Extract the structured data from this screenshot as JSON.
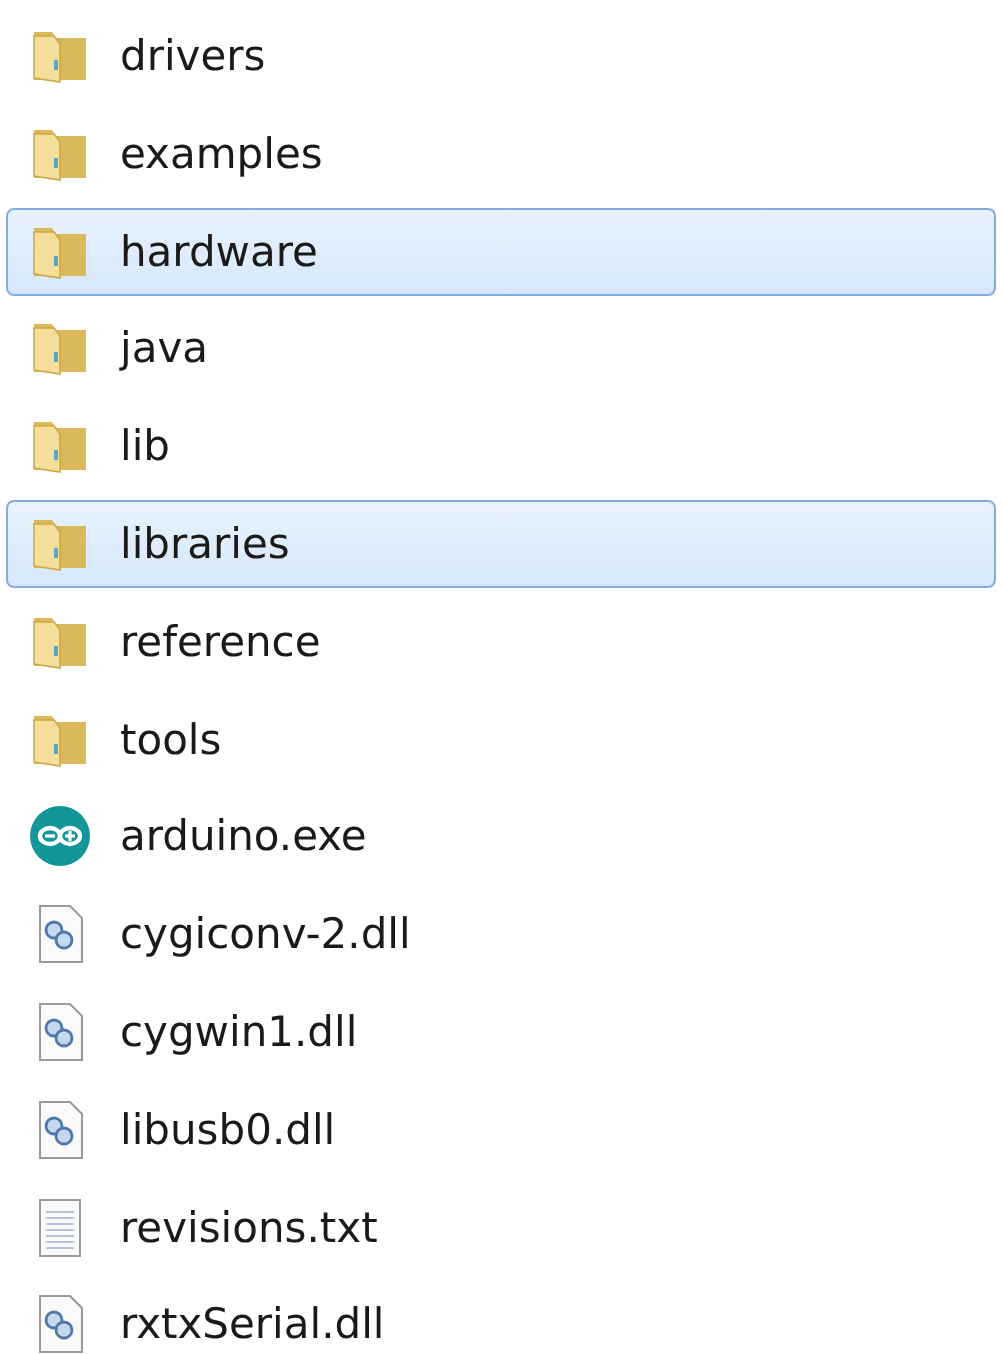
{
  "files": [
    {
      "name": "drivers",
      "kind": "folder",
      "selected": false
    },
    {
      "name": "examples",
      "kind": "folder",
      "selected": false
    },
    {
      "name": "hardware",
      "kind": "folder",
      "selected": true
    },
    {
      "name": "java",
      "kind": "folder",
      "selected": false
    },
    {
      "name": "lib",
      "kind": "folder",
      "selected": false
    },
    {
      "name": "libraries",
      "kind": "folder",
      "selected": true
    },
    {
      "name": "reference",
      "kind": "folder",
      "selected": false
    },
    {
      "name": "tools",
      "kind": "folder",
      "selected": false
    },
    {
      "name": "arduino.exe",
      "kind": "app",
      "selected": false
    },
    {
      "name": "cygiconv-2.dll",
      "kind": "dll",
      "selected": false
    },
    {
      "name": "cygwin1.dll",
      "kind": "dll",
      "selected": false
    },
    {
      "name": "libusb0.dll",
      "kind": "dll",
      "selected": false
    },
    {
      "name": "revisions.txt",
      "kind": "text",
      "selected": false
    },
    {
      "name": "rxtxSerial.dll",
      "kind": "dll",
      "selected": false
    }
  ]
}
